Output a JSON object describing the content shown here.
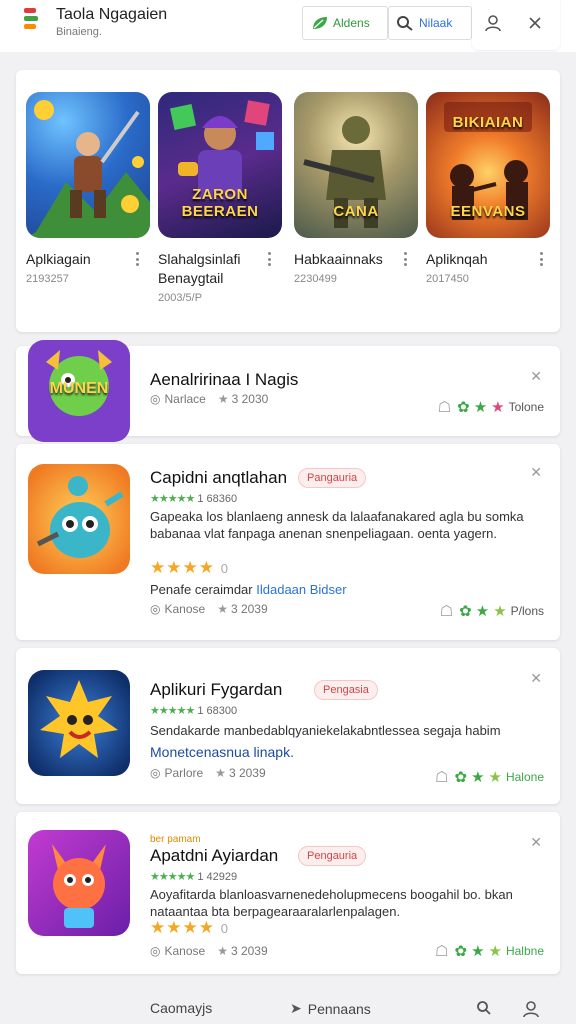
{
  "header": {
    "title": "Taola Ngagaien",
    "subtitle": "Binaieng.",
    "btn_a_label": "Aldens",
    "btn_b_label": "Nilaak",
    "icons": [
      "leaf-icon",
      "search-icon",
      "user-icon",
      "close-icon"
    ]
  },
  "featured": [
    {
      "name": "Aplkiagain",
      "meta": "2193257",
      "tag": ""
    },
    {
      "name": "Slahalgsinlafi Benaygtail",
      "meta": "2003/5/P",
      "tag": "ZARON BEERAEN"
    },
    {
      "name": "Habkaainnaks",
      "meta": "2230499",
      "tag": "CANA"
    },
    {
      "name": "Apliknqah",
      "meta": "2017450",
      "tag": "EENVANS"
    }
  ],
  "cards": [
    {
      "title": "Aenalririnaa I Nagis",
      "foot_left": "Narlace",
      "foot_count": "3 2030",
      "action": "Tolone",
      "icon_text": "MUNEN"
    },
    {
      "title": "Capidni anqtlahan",
      "badge": "Pangauria",
      "rating": "1 68360",
      "desc": "Gapeaka los blanlaeng annesk da lalaafanakared agla bu somka babanaa vlat fanpaga anenan snenpeliagaan. oenta yagern.",
      "stars_note": "0",
      "extra_prefix": "Penafe ceraimdar",
      "extra_link": "Ildadaan Bidser",
      "foot_left": "Kanose",
      "foot_count": "3 2039",
      "action": "P/lons"
    },
    {
      "title": "Aplikuri Fygardan",
      "badge": "Pengasia",
      "rating": "1 68300",
      "desc": "Sendakarde manbedablqyaniekelakabntlessea segaja habim",
      "link": "Monetcenasnua linapk.",
      "foot_left": "Parlore",
      "foot_count": "3 2039",
      "action": "Halone"
    },
    {
      "title": "Apatdni Ayiardan",
      "note": "ber pamam",
      "badge": "Pengauria",
      "rating": "1 42929",
      "desc": "Aoyafitarda blanloasvarnenedeholupmecens boogahil bo. bkan nataantaa bta berpagearaaralarlenpalagen.",
      "stars_note": "0",
      "foot_left": "Kanose",
      "foot_count": "3 2039",
      "action": "Halbne"
    }
  ],
  "bottom_nav": {
    "left": "Caomayjs",
    "mid": "Pennaans"
  },
  "colors": {
    "green": "#3aa845",
    "blue": "#2b72d6",
    "badge_red": "#d24545",
    "star_gold": "#f5a623"
  }
}
